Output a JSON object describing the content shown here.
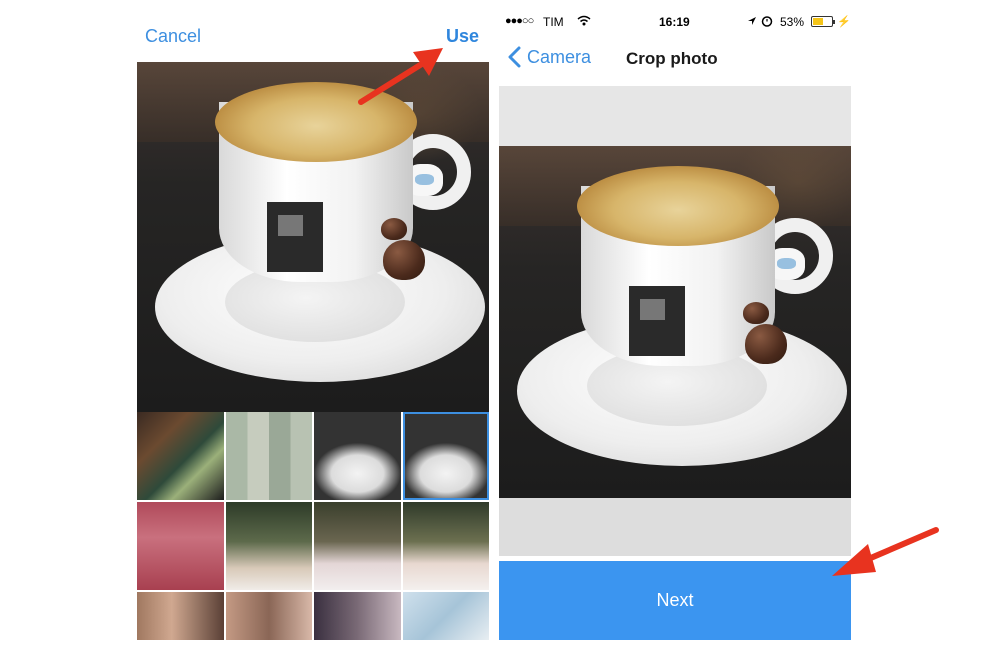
{
  "left": {
    "cancel_label": "Cancel",
    "use_label": "Use"
  },
  "right": {
    "status": {
      "signal": "●●●○○",
      "carrier": "TIM",
      "time": "16:19",
      "battery": "53%",
      "battery_level": 0.53
    },
    "back_label": "Camera",
    "title": "Crop photo",
    "next_label": "Next"
  },
  "colors": {
    "accent": "#3d8fe0",
    "next_button": "#3b95f0",
    "arrow": "#e8331f"
  },
  "icons": [
    "chevron-left-icon",
    "wifi-icon",
    "location-icon",
    "alarm-icon",
    "battery-icon",
    "charging-icon"
  ]
}
